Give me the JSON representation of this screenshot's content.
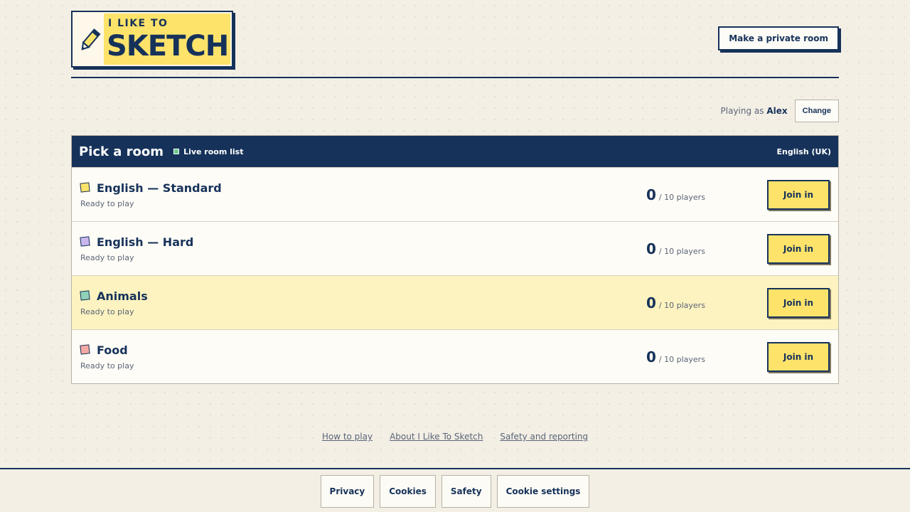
{
  "header": {
    "logo_small": "I LIKE TO",
    "logo_big": "SKETCH",
    "private_room_label": "Make a private room"
  },
  "player": {
    "prefix": "Playing as",
    "name": "Alex",
    "change_label": "Change"
  },
  "rooms_panel": {
    "title": "Pick a room",
    "live_label": "Live room list",
    "language": "English (UK)",
    "rooms": [
      {
        "name": "English — Standard",
        "status": "Ready to play",
        "count": "0",
        "capacity": "/ 10 players",
        "join_label": "Join in",
        "color": "#fee36a"
      },
      {
        "name": "English — Hard",
        "status": "Ready to play",
        "count": "0",
        "capacity": "/ 10 players",
        "join_label": "Join in",
        "color": "#c9b8ee"
      },
      {
        "name": "Animals",
        "status": "Ready to play",
        "count": "0",
        "capacity": "/ 10 players",
        "join_label": "Join in",
        "color": "#8fd1b9"
      },
      {
        "name": "Food",
        "status": "Ready to play",
        "count": "0",
        "capacity": "/ 10 players",
        "join_label": "Join in",
        "color": "#f4a9a2"
      }
    ]
  },
  "footer_links": {
    "how_to_play": "How to play",
    "about": "About I Like To Sketch",
    "safety_reporting": "Safety and reporting"
  },
  "bottom_bar": {
    "privacy": "Privacy",
    "cookies": "Cookies",
    "safety": "Safety",
    "cookie_settings": "Cookie settings"
  },
  "colors": {
    "navy": "#16325a",
    "accent_yellow": "#fee36a",
    "highlight_row": "#fdf3c0",
    "background": "#f3efe5"
  },
  "icons": {
    "logo": "pencil-icon",
    "live": "live-indicator-icon"
  }
}
